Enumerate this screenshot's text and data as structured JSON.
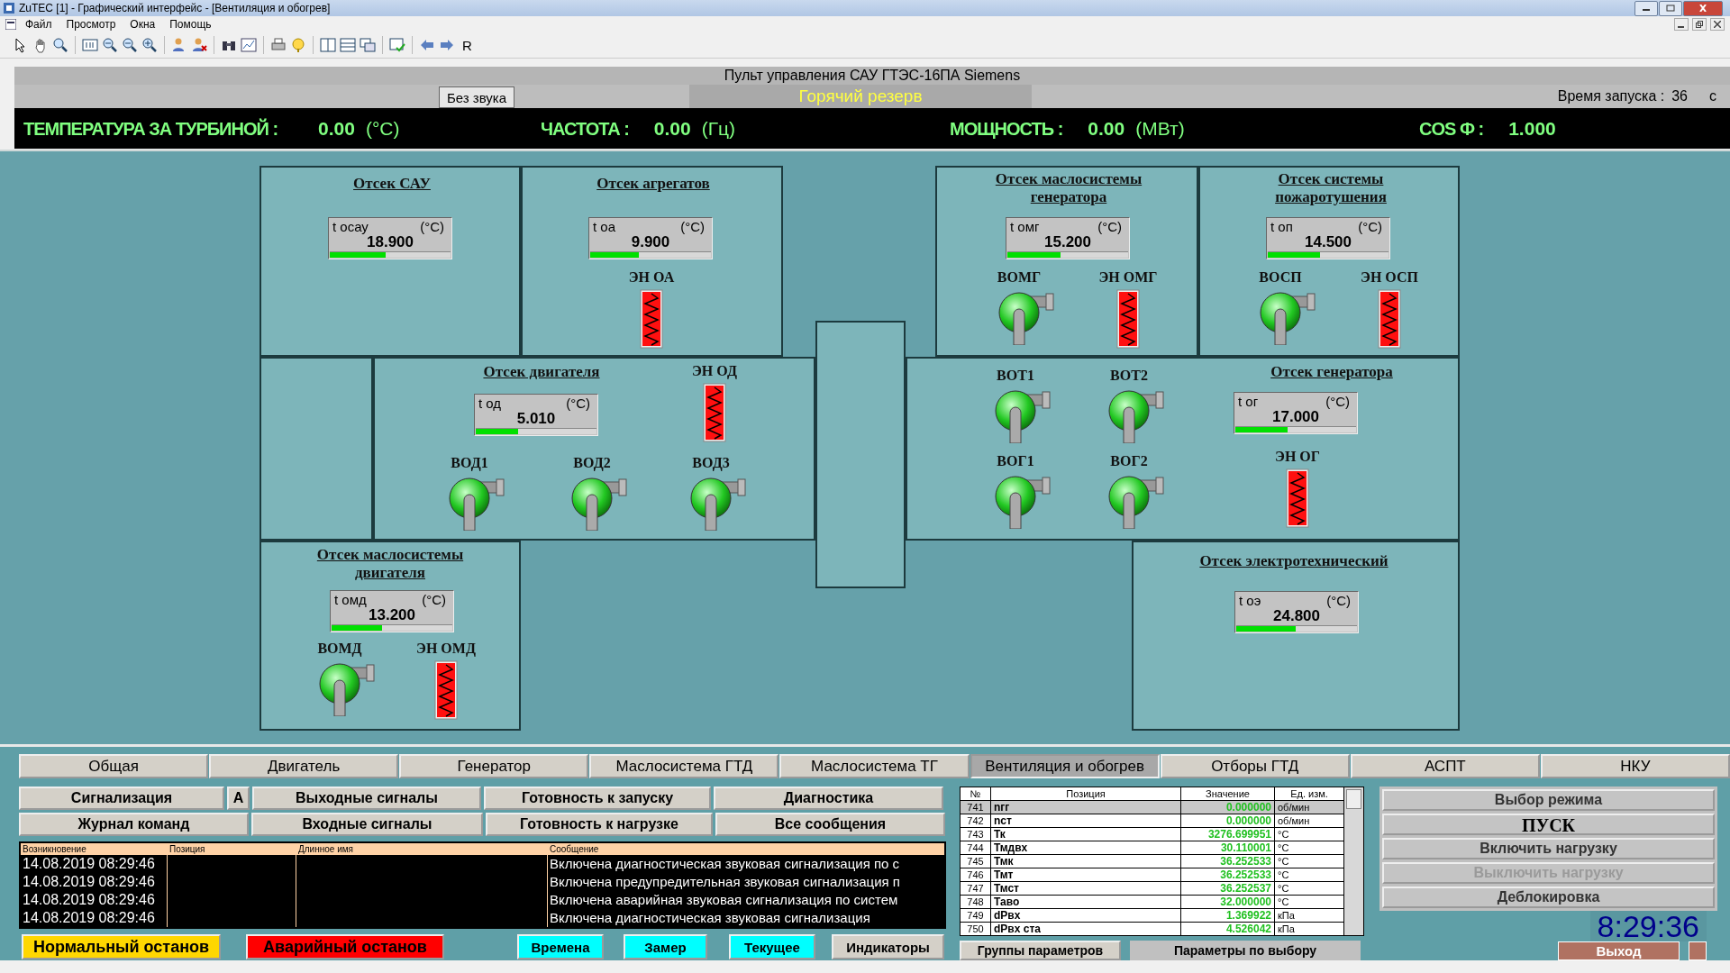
{
  "window": {
    "title": "ZuTEC [1] - Графический интерфейс - [Вентиляция и обогрев]"
  },
  "menu": [
    "Файл",
    "Просмотр",
    "Окна",
    "Помощь"
  ],
  "toolbar": {
    "text_button": "R"
  },
  "header": {
    "title": "Пульт управления САУ ГТЭС-16ПА Siemens",
    "mute_button": "Без звука",
    "mode": "Горячий резерв",
    "start_label": "Время запуска :",
    "start_value": "36",
    "start_unit": "с",
    "metrics": [
      {
        "label": "ТЕМПЕРАТУРА ЗА ТУРБИНОЙ :",
        "value": "0.00",
        "unit": "(°C)"
      },
      {
        "label": "ЧАСТОТА :",
        "value": "0.00",
        "unit": "(Гц)"
      },
      {
        "label": "МОЩНОСТЬ :",
        "value": "0.00",
        "unit": "(МВт)"
      },
      {
        "label": "COS Ф :",
        "value": "1.000"
      }
    ]
  },
  "compartments": [
    {
      "title": "Отсек САУ",
      "gauge": {
        "label": "t осау",
        "unit": "(°C)",
        "value": "18.900",
        "level": 0.46
      }
    },
    {
      "title": "Отсек агрегатов",
      "gauge": {
        "label": "t оа",
        "unit": "(°C)",
        "value": "9.900",
        "level": 0.4
      },
      "devices": [
        {
          "kind": "heater",
          "label": "ЭН ОА",
          "on": true
        }
      ]
    },
    {
      "title": "Отсек маслосистемы генератора",
      "gauge": {
        "label": "t омг",
        "unit": "(°C)",
        "value": "15.200",
        "level": 0.44
      },
      "devices": [
        {
          "kind": "fan",
          "label": "ВОМГ",
          "on": true
        },
        {
          "kind": "heater",
          "label": "ЭН ОМГ",
          "on": true
        }
      ]
    },
    {
      "title": "Отсек системы пожаротушения",
      "gauge": {
        "label": "t оп",
        "unit": "(°C)",
        "value": "14.500",
        "level": 0.43
      },
      "devices": [
        {
          "kind": "fan",
          "label": "ВОСП",
          "on": true
        },
        {
          "kind": "heater",
          "label": "ЭН ОСП",
          "on": true
        }
      ]
    },
    {
      "title": "Отсек двигателя",
      "gauge": {
        "label": "t од",
        "unit": "(°C)",
        "value": "5.010",
        "level": 0.35
      },
      "devices": [
        {
          "kind": "heater",
          "label": "ЭН ОД",
          "on": true
        },
        {
          "kind": "fan",
          "label": "ВОД1",
          "on": true
        },
        {
          "kind": "fan",
          "label": "ВОД2",
          "on": true
        },
        {
          "kind": "fan",
          "label": "ВОД3",
          "on": true
        }
      ]
    },
    {
      "title": "Отсек генератора",
      "gauge": {
        "label": "t ог",
        "unit": "(°C)",
        "value": "17.000",
        "level": 0.43
      },
      "devices": [
        {
          "kind": "fan",
          "label": "ВОТ1",
          "on": true
        },
        {
          "kind": "fan",
          "label": "ВОТ2",
          "on": true
        },
        {
          "kind": "fan",
          "label": "ВОГ1",
          "on": true
        },
        {
          "kind": "fan",
          "label": "ВОГ2",
          "on": true
        },
        {
          "kind": "heater",
          "label": "ЭН ОГ",
          "on": true
        }
      ]
    },
    {
      "title": "Отсек маслосистемы двигателя",
      "gauge": {
        "label": "t омд",
        "unit": "(°C)",
        "value": "13.200",
        "level": 0.42
      },
      "devices": [
        {
          "kind": "fan",
          "label": "ВОМД",
          "on": true
        },
        {
          "kind": "heater",
          "label": "ЭН ОМД",
          "on": true
        }
      ]
    },
    {
      "title": "Отсек электротехнический",
      "gauge": {
        "label": "t оэ",
        "unit": "(°C)",
        "value": "24.800",
        "level": 0.49
      }
    }
  ],
  "tabs": [
    {
      "label": "Общая",
      "selected": false
    },
    {
      "label": "Двигатель",
      "selected": false
    },
    {
      "label": "Генератор",
      "selected": false
    },
    {
      "label": "Маслосистема ГТД",
      "selected": false
    },
    {
      "label": "Маслосистема ТГ",
      "selected": false
    },
    {
      "label": "Вентиляция и обогрев",
      "selected": true
    },
    {
      "label": "Отборы ГТД",
      "selected": false
    },
    {
      "label": "АСПТ",
      "selected": false
    },
    {
      "label": "НКУ",
      "selected": false
    }
  ],
  "nav_buttons": [
    [
      "Сигнализация",
      "A",
      "Выходные сигналы",
      "Готовность к запуску",
      "Диагностика"
    ],
    [
      "Журнал команд",
      "Входные сигналы",
      "Готовность к нагрузке",
      "Все сообщения"
    ]
  ],
  "alarms": {
    "columns": [
      "Возникновение",
      "Позиция",
      "Длинное имя",
      "Сообщение"
    ],
    "rows": [
      {
        "time": "14.08.2019 08:29:46",
        "message": "Включена диагностическая звуковая сигнализация по с"
      },
      {
        "time": "14.08.2019 08:29:46",
        "message": "Включена предупредительная звуковая сигнализация п"
      },
      {
        "time": "14.08.2019 08:29:46",
        "message": "Включена аварийная звуковая сигнализация по систем"
      },
      {
        "time": "14.08.2019 08:29:46",
        "message": "Включена диагностическая звуковая сигнализация"
      }
    ]
  },
  "action_buttons": [
    {
      "label": "Нормальный останов",
      "color": "#ffd700"
    },
    {
      "label": "Аварийный останов",
      "color": "#ff0000"
    },
    {
      "label": "Времена",
      "color": "#00ffff"
    },
    {
      "label": "Замер",
      "color": "#00ffff"
    },
    {
      "label": "Текущее",
      "color": "#00ffff"
    },
    {
      "label": "Индикаторы",
      "color": "#d4d0c8"
    }
  ],
  "params": {
    "columns": [
      "№",
      "Позиция",
      "Значение",
      "Ед. изм."
    ],
    "rows": [
      {
        "no": "741",
        "name": "nгг",
        "value": "0.000000",
        "unit": "об/мин",
        "selected": true
      },
      {
        "no": "742",
        "name": "nст",
        "value": "0.000000",
        "unit": "об/мин",
        "selected": false
      },
      {
        "no": "743",
        "name": "Тк",
        "value": "3276.699951",
        "unit": "°С",
        "selected": false
      },
      {
        "no": "744",
        "name": "Тмдвх",
        "value": "30.110001",
        "unit": "°С",
        "selected": false
      },
      {
        "no": "745",
        "name": "Тмк",
        "value": "36.252533",
        "unit": "°С",
        "selected": false
      },
      {
        "no": "746",
        "name": "Тмт",
        "value": "36.252533",
        "unit": "°С",
        "selected": false
      },
      {
        "no": "747",
        "name": "Тмст",
        "value": "36.252537",
        "unit": "°С",
        "selected": false
      },
      {
        "no": "748",
        "name": "Таво",
        "value": "32.000000",
        "unit": "°С",
        "selected": false
      },
      {
        "no": "749",
        "name": "dPвх",
        "value": "1.369922",
        "unit": "кПа",
        "selected": false
      },
      {
        "no": "750",
        "name": "dPвх ста",
        "value": "4.526042",
        "unit": "кПа",
        "selected": false
      }
    ]
  },
  "param_buttons": [
    "Группы параметров",
    "Параметры по выбору"
  ],
  "control_buttons": [
    {
      "label": "Выбор режима",
      "kind": "normal",
      "disabled": false
    },
    {
      "label": "ПУСК",
      "kind": "primary",
      "disabled": false
    },
    {
      "label": "Включить нагрузку",
      "kind": "normal",
      "disabled": false
    },
    {
      "label": "Выключить нагрузку",
      "kind": "normal",
      "disabled": true
    },
    {
      "label": "Деблокировка",
      "kind": "normal",
      "disabled": false
    }
  ],
  "clock": "8:29:36",
  "exit_button": "Выход"
}
